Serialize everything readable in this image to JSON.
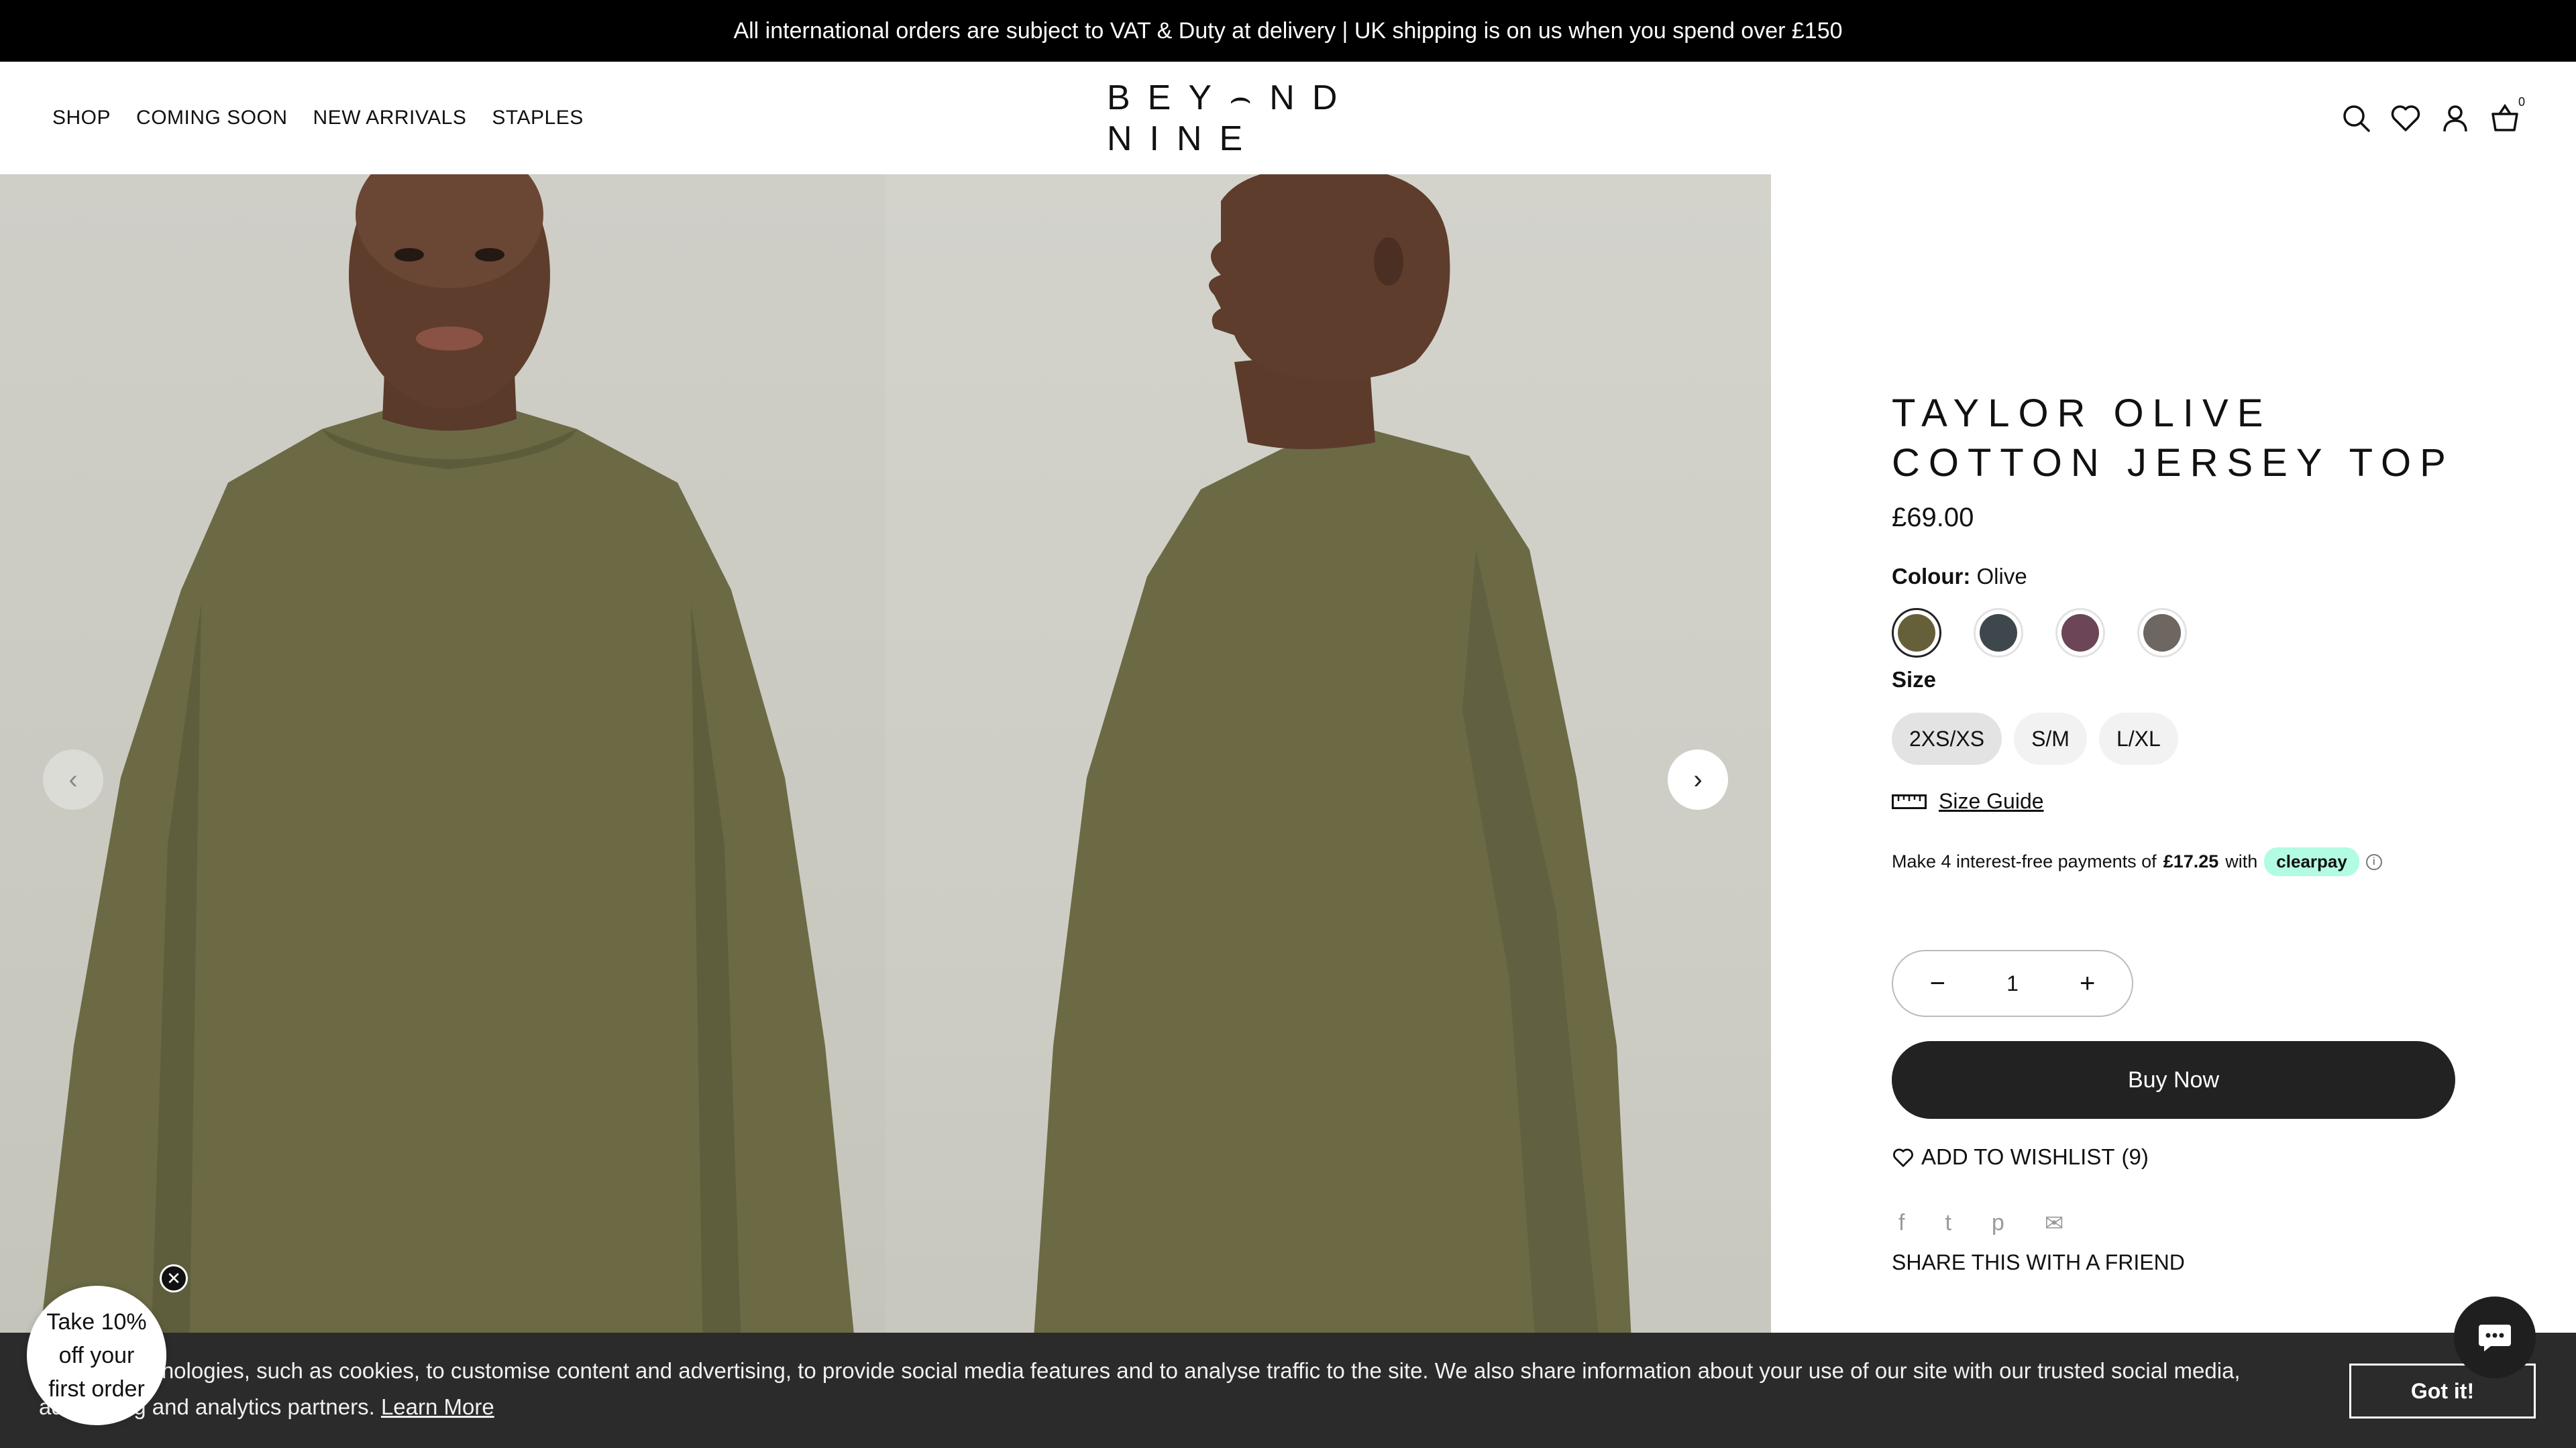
{
  "announcement": "All international orders are subject to VAT & Duty at delivery | UK shipping is on us when you spend over £150",
  "nav": {
    "items": [
      "SHOP",
      "COMING SOON",
      "NEW ARRIVALS",
      "STAPLES"
    ]
  },
  "logo": "BEY⌢ND NINE",
  "header_icons": {
    "search": "search-icon",
    "wishlist": "heart-icon",
    "account": "user-icon",
    "cart": "basket-icon",
    "cart_count": "0"
  },
  "gallery": {
    "prev": "‹",
    "next": "›"
  },
  "product": {
    "title_line1": "TAYLOR OLIVE",
    "title_line2": "COTTON JERSEY TOP",
    "price": "£69.00",
    "colour_label": "Colour:",
    "colour_value": "Olive",
    "swatches": [
      {
        "name": "olive",
        "color": "#66603a",
        "selected": true
      },
      {
        "name": "charcoal",
        "color": "#3e474c",
        "selected": false
      },
      {
        "name": "plum",
        "color": "#6c4557",
        "selected": false
      },
      {
        "name": "taupe",
        "color": "#6d6661",
        "selected": false
      }
    ],
    "size_label": "Size",
    "sizes": [
      "2XS/XS",
      "S/M",
      "L/XL"
    ],
    "selected_size": "2XS/XS",
    "size_guide": "Size Guide",
    "clearpay_prefix": "Make 4 interest-free payments of",
    "clearpay_amount": "£17.25",
    "clearpay_with": "with",
    "clearpay_brand": "clearpay",
    "quantity": "1",
    "qty_minus": "−",
    "qty_plus": "+",
    "buy_now": "Buy Now",
    "add_to_wishlist": "ADD TO WISHLIST",
    "wishlist_count": "(9)",
    "social": [
      "f",
      "t",
      "p",
      "✉"
    ],
    "share": "SHARE THIS WITH A FRIEND"
  },
  "cookie": {
    "text": "We use technologies, such as cookies, to customise content and advertising, to provide social media features and to analyse traffic to the site. We also share information about your use of our site with our trusted social media, advertising and analytics partners.",
    "learn_more": "Learn More",
    "got_it": "Got it!"
  },
  "discount": {
    "line1": "Take 10%",
    "line2": "off your",
    "line3": "first order",
    "close": "✕"
  }
}
